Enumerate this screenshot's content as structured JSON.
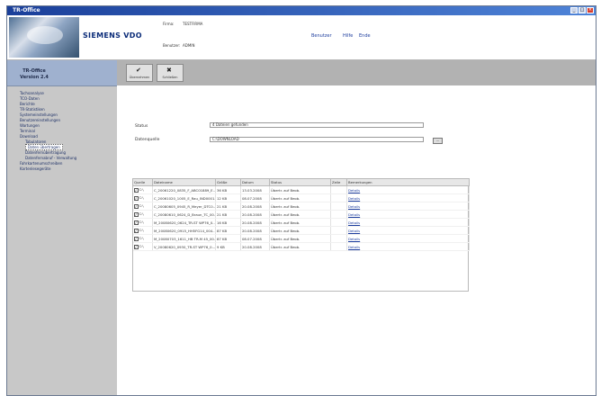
{
  "window": {
    "title": "TR-Office"
  },
  "header": {
    "logo": "SIEMENS VDO",
    "field1_label": "Firma:",
    "field1_value": "TESTFIRMA",
    "field2_label": "Benutzer:",
    "field2_value": "ADMIN",
    "links": [
      "Benutzer",
      "Hilfe",
      "Ende"
    ]
  },
  "sidebar": {
    "product": "TR-Office",
    "version": "Version 2.4",
    "tree": [
      {
        "label": "Tachoanalyse",
        "level": 0
      },
      {
        "label": "TCO-Daten",
        "level": 0
      },
      {
        "label": "Berichte",
        "level": 0
      },
      {
        "label": "TR-Statistiken",
        "level": 0
      },
      {
        "label": "Systemeinstellungen",
        "level": 0
      },
      {
        "label": "Benutzereinstellungen",
        "level": 0
      },
      {
        "label": "Wartungen",
        "level": 0
      },
      {
        "label": "Terminal",
        "level": 0
      },
      {
        "label": "Download",
        "level": 0
      },
      {
        "label": "Tabulatoren",
        "level": 1
      },
      {
        "label": "Daten übertragen",
        "level": 1,
        "selected": true
      },
      {
        "label": "Datenfernübertragung",
        "level": 1
      },
      {
        "label": "Datenfernabruf - Verwaltung",
        "level": 1
      },
      {
        "label": "Fahrkartenumschreiben",
        "level": 0
      },
      {
        "label": "Kartenlesegeräte",
        "level": 0
      }
    ]
  },
  "toolbar": {
    "buttons": [
      {
        "label": "Übernehmen",
        "icon": "check-icon"
      },
      {
        "label": "Schließen",
        "icon": "close-icon"
      }
    ]
  },
  "form": {
    "status_label": "Status",
    "status_value": "4 Dateien gefunden",
    "source_label": "Datenquelle",
    "source_value": "C:\\DOWNLOAD",
    "browse_label": "..."
  },
  "table": {
    "headers": [
      "Quelle",
      "Dateiname",
      "Größe",
      "Datum",
      "Status",
      "Zeile",
      "Bemerkungen"
    ],
    "rows": [
      {
        "src": "C:\\",
        "file": "C_20061220_0835_F_ABC01889_E...",
        "size": "36 KB",
        "date": "13.03.2008",
        "status": "Übertr. auf Beob.",
        "line": "",
        "link": "Details"
      },
      {
        "src": "C:\\",
        "file": "C_20061020_1005_E_Rau_IND0001...",
        "size": "12 KB",
        "date": "08.07.2008",
        "status": "Übertr. auf Beob.",
        "line": "",
        "link": "Details"
      },
      {
        "src": "C:\\",
        "file": "C_20080605_0945_R_Meyer_DTC0...",
        "size": "21 KB",
        "date": "20.08.2008",
        "status": "Übertr. auf Beob.",
        "line": "",
        "link": "Details"
      },
      {
        "src": "C:\\",
        "file": "C_20080610_0624_D_Braun_TC_00...",
        "size": "21 KB",
        "date": "20.08.2008",
        "status": "Übertr. auf Beob.",
        "line": "",
        "link": "Details"
      },
      {
        "src": "C:\\",
        "file": "M_20080620_0624_TR-ST WP76_0...",
        "size": "16 KB",
        "date": "20.08.2008",
        "status": "Übertr. auf Beob.",
        "line": "",
        "link": "Details"
      },
      {
        "src": "C:\\",
        "file": "M_20080620_0915_HH5FG14_004...",
        "size": "87 KB",
        "date": "20.08.2008",
        "status": "Übertr. auf Beob.",
        "line": "",
        "link": "Details"
      },
      {
        "src": "C:\\",
        "file": "M_20080703_1611_HB TR-M 45_00...",
        "size": "87 KB",
        "date": "08.07.2008",
        "status": "Übertr. auf Beob.",
        "line": "",
        "link": "Details"
      },
      {
        "src": "C:\\",
        "file": "V_20080620_0930_TR-ST WP76_0...",
        "size": "9 KB",
        "date": "20.08.2008",
        "status": "Übertr. auf Beob.",
        "line": "",
        "link": "Details"
      }
    ]
  }
}
